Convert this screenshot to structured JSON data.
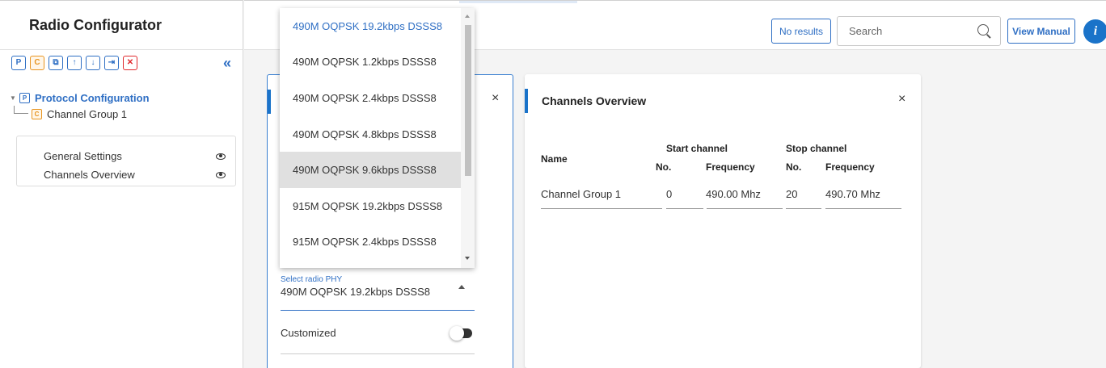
{
  "app": {
    "title": "Radio Configurator"
  },
  "toolbar": {
    "buttons": [
      {
        "icon": "protocol-icon",
        "glyph": "P"
      },
      {
        "icon": "channel-group-icon",
        "glyph": "C"
      },
      {
        "icon": "copy-icon",
        "glyph": "⧉"
      },
      {
        "icon": "arrow-up-icon",
        "glyph": "↑"
      },
      {
        "icon": "arrow-down-icon",
        "glyph": "↓"
      },
      {
        "icon": "import-icon",
        "glyph": "⇥"
      },
      {
        "icon": "delete-icon",
        "glyph": "✕"
      }
    ],
    "collapse_glyph": "«"
  },
  "tree": {
    "root": {
      "badge": "P",
      "label": "Protocol Configuration"
    },
    "child": {
      "badge": "C",
      "label": "Channel Group 1"
    }
  },
  "settings_panel": {
    "items": [
      {
        "label": "General Settings"
      },
      {
        "label": "Channels Overview"
      }
    ]
  },
  "topbar": {
    "no_results": "No results",
    "search_placeholder": "Search",
    "view_manual": "View Manual",
    "info_glyph": "i"
  },
  "general_settings": {
    "close_glyph": "×",
    "phy_label": "Select radio PHY",
    "phy_value": "490M OQPSK 19.2kbps DSSS8",
    "customized_label": "Customized",
    "customized_on": false
  },
  "phy_dropdown": {
    "options": [
      "490M OQPSK 19.2kbps DSSS8",
      "490M OQPSK 1.2kbps DSSS8",
      "490M OQPSK 2.4kbps DSSS8",
      "490M OQPSK 4.8kbps DSSS8",
      "490M OQPSK 9.6kbps DSSS8",
      "915M OQPSK 19.2kbps DSSS8",
      "915M OQPSK 2.4kbps DSSS8"
    ],
    "selected_index": 0,
    "hover_index": 4
  },
  "channels_overview": {
    "title": "Channels Overview",
    "close_glyph": "×",
    "headers": {
      "name": "Name",
      "start_channel": "Start channel",
      "stop_channel": "Stop channel",
      "no": "No.",
      "frequency": "Frequency"
    },
    "rows": [
      {
        "name": "Channel Group 1",
        "start_no": "0",
        "start_freq": "490.00 Mhz",
        "stop_no": "20",
        "stop_freq": "490.70 Mhz"
      }
    ]
  }
}
